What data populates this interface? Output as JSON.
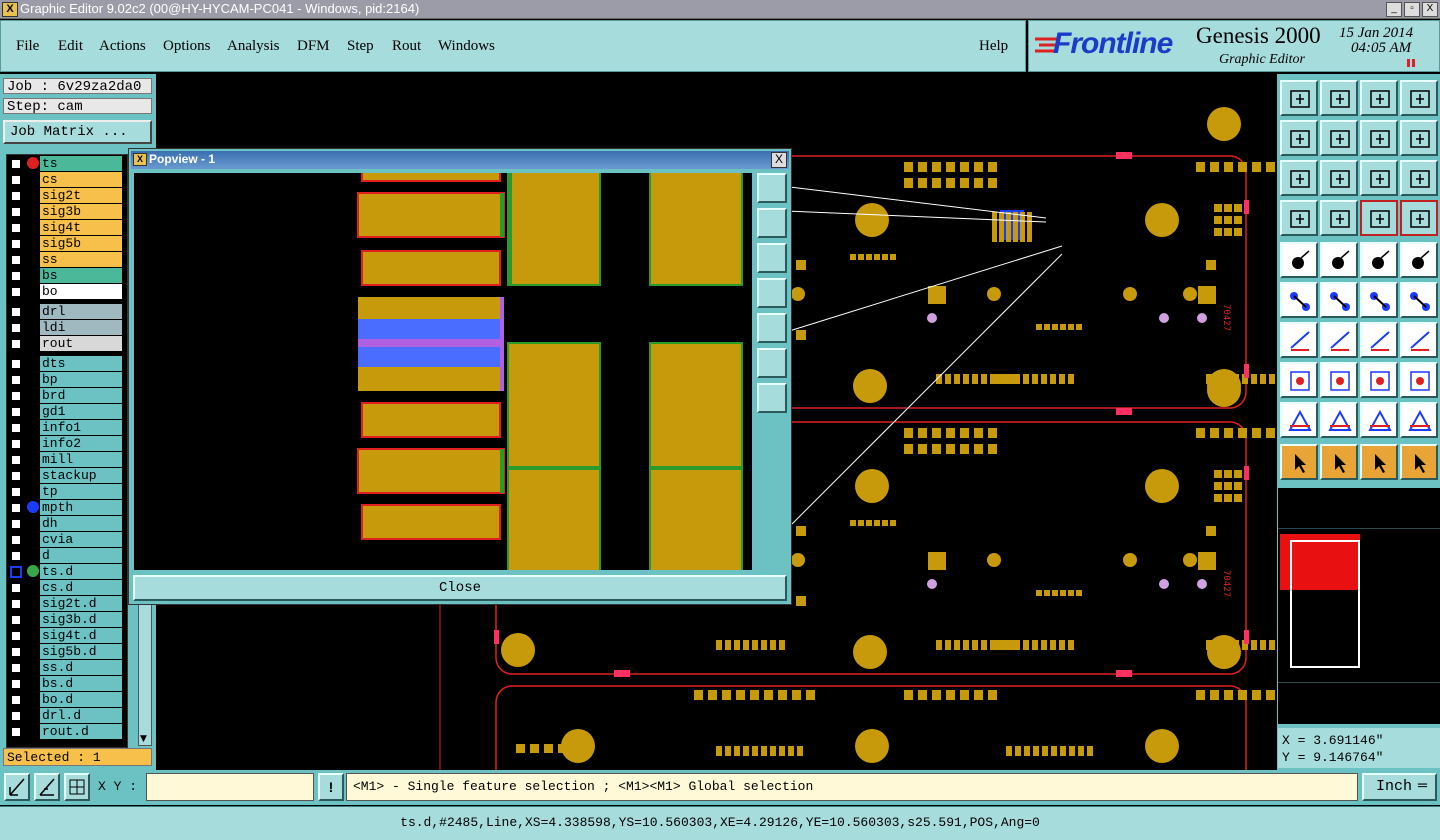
{
  "window": {
    "title": "Graphic Editor 9.02c2 (00@HY-HYCAM-PC041 - Windows, pid:2164)",
    "buttons": [
      "_",
      "▫",
      "X"
    ]
  },
  "menu": [
    "File",
    "Edit",
    "Actions",
    "Options",
    "Analysis",
    "DFM",
    "Step",
    "Rout",
    "Windows"
  ],
  "help": "Help",
  "brand": {
    "logo": "Frontline",
    "product": "Genesis 2000",
    "subtitle": "Graphic Editor",
    "date": "15 Jan 2014",
    "time": "04:05 AM"
  },
  "job": {
    "job_label": "Job : 6v29za2da0",
    "step_label": "Step: cam",
    "matrix_button": "Job Matrix ..."
  },
  "layers": [
    {
      "name": "ts",
      "bg": "#4cb89a",
      "dot": "#e02020"
    },
    {
      "name": "cs",
      "bg": "#f7c04a"
    },
    {
      "name": "sig2t",
      "bg": "#f7c04a"
    },
    {
      "name": "sig3b",
      "bg": "#f7c04a"
    },
    {
      "name": "sig4t",
      "bg": "#f7c04a"
    },
    {
      "name": "sig5b",
      "bg": "#f7c04a"
    },
    {
      "name": "ss",
      "bg": "#f7c04a"
    },
    {
      "name": "bs",
      "bg": "#4cb89a"
    },
    {
      "name": "bo",
      "bg": "#ffffff"
    },
    {
      "name": "drl",
      "bg": "#a0b8c0"
    },
    {
      "name": "ldi",
      "bg": "#a0b8c0"
    },
    {
      "name": "rout",
      "bg": "#d8d8d8"
    },
    {
      "name": "dts",
      "bg": "#6cc2c2"
    },
    {
      "name": "bp",
      "bg": "#6cc2c2"
    },
    {
      "name": "brd",
      "bg": "#6cc2c2"
    },
    {
      "name": "gd1",
      "bg": "#6cc2c2"
    },
    {
      "name": "info1",
      "bg": "#6cc2c2"
    },
    {
      "name": "info2",
      "bg": "#6cc2c2"
    },
    {
      "name": "mill",
      "bg": "#6cc2c2"
    },
    {
      "name": "stackup",
      "bg": "#6cc2c2"
    },
    {
      "name": "tp",
      "bg": "#6cc2c2"
    },
    {
      "name": "mpth",
      "bg": "#6cc2c2",
      "dot": "#1a3cff"
    },
    {
      "name": "dh",
      "bg": "#6cc2c2"
    },
    {
      "name": "cvia",
      "bg": "#6cc2c2"
    },
    {
      "name": "d",
      "bg": "#6cc2c2"
    },
    {
      "name": "ts.d",
      "bg": "#6cc2c2",
      "dot": "#3aa64a",
      "active": true
    },
    {
      "name": "cs.d",
      "bg": "#6cc2c2"
    },
    {
      "name": "sig2t.d",
      "bg": "#6cc2c2"
    },
    {
      "name": "sig3b.d",
      "bg": "#6cc2c2"
    },
    {
      "name": "sig4t.d",
      "bg": "#6cc2c2"
    },
    {
      "name": "sig5b.d",
      "bg": "#6cc2c2"
    },
    {
      "name": "ss.d",
      "bg": "#6cc2c2"
    },
    {
      "name": "bs.d",
      "bg": "#6cc2c2"
    },
    {
      "name": "bo.d",
      "bg": "#6cc2c2"
    },
    {
      "name": "drl.d",
      "bg": "#6cc2c2"
    },
    {
      "name": "rout.d",
      "bg": "#6cc2c2"
    }
  ],
  "selected": "Selected : 1",
  "popview": {
    "title": "Popview - 1",
    "close_button": "Close",
    "close_x": "X"
  },
  "coords": {
    "x": "X = 3.691146\"",
    "y": "Y = 9.146764\""
  },
  "bottom": {
    "xy_label": "X Y :",
    "xy_value": "",
    "warn": "!",
    "prompt": "<M1> - Single feature selection ; <M1><M1> Global selection",
    "units": "Inch"
  },
  "status": "ts.d,#2485,Line,XS=4.338598,YS=10.560303,XE=4.29126,YE=10.560303,s25.591,POS,Ang=0",
  "colors": {
    "pad": "#c79a0c",
    "outline": "#e02020",
    "ui": "#6cc2c2",
    "ui_light": "#a6dcdc"
  }
}
